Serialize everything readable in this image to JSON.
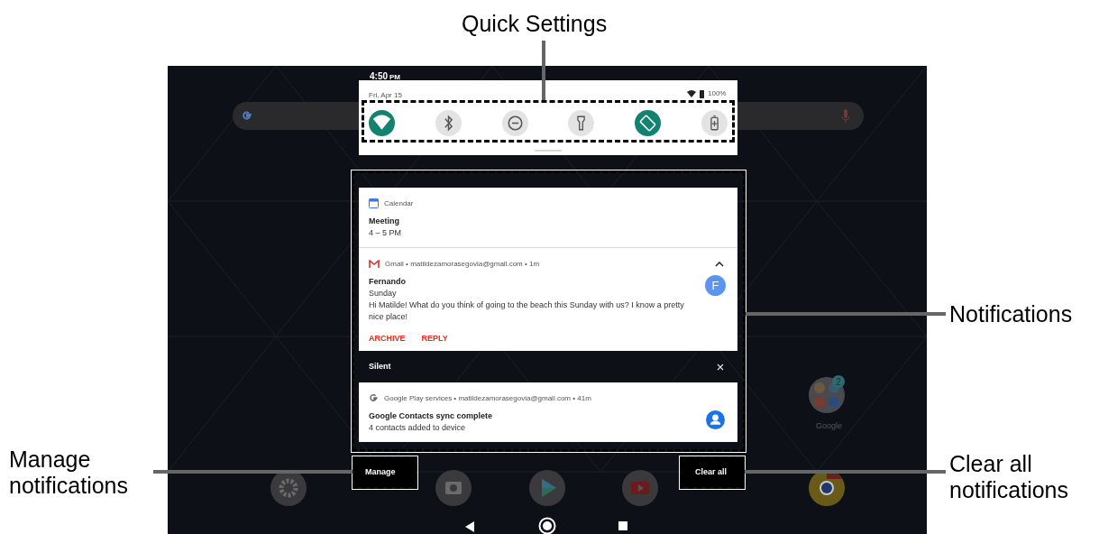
{
  "callouts": {
    "quick_settings": "Quick Settings",
    "notifications": "Notifications",
    "manage": "Manage\nnotifications",
    "clear_all": "Clear all\nnotifications"
  },
  "status_bar": {
    "time": "4:50",
    "ampm": "PM"
  },
  "quick_settings": {
    "date": "Fri, Apr 15",
    "battery": "100%",
    "tiles": [
      {
        "kind": "wifi",
        "on": true
      },
      {
        "kind": "bluetooth",
        "on": false
      },
      {
        "kind": "dnd",
        "on": false
      },
      {
        "kind": "flashlight",
        "on": false
      },
      {
        "kind": "rotate",
        "on": true
      },
      {
        "kind": "battery",
        "on": false
      }
    ]
  },
  "notifications": [
    {
      "kind": "calendar",
      "header": "Calendar",
      "title": "Meeting",
      "lines": [
        "4 – 5 PM"
      ]
    },
    {
      "kind": "gmail",
      "header": "Gmail • matildezamorasegovia@gmail.com • 1m",
      "title": "Fernando",
      "lines": [
        "Sunday",
        "Hi Matilde! What do you think of going to the beach this Sunday with us? I know a pretty nice place!"
      ],
      "avatar": "F",
      "expanded": true,
      "actions": [
        "ARCHIVE",
        "REPLY"
      ]
    }
  ],
  "silent": {
    "label": "Silent",
    "notifications": [
      {
        "kind": "google",
        "header": "Google Play services • matildezamorasegovia@gmail.com • 41m",
        "title": "Google Contacts sync complete",
        "lines": [
          "4 contacts added to device"
        ],
        "contact_icon": true
      }
    ]
  },
  "buttons": {
    "manage": "Manage",
    "clear_all": "Clear all"
  },
  "home": {
    "folder_label": "Google",
    "folder_badge": "2"
  }
}
